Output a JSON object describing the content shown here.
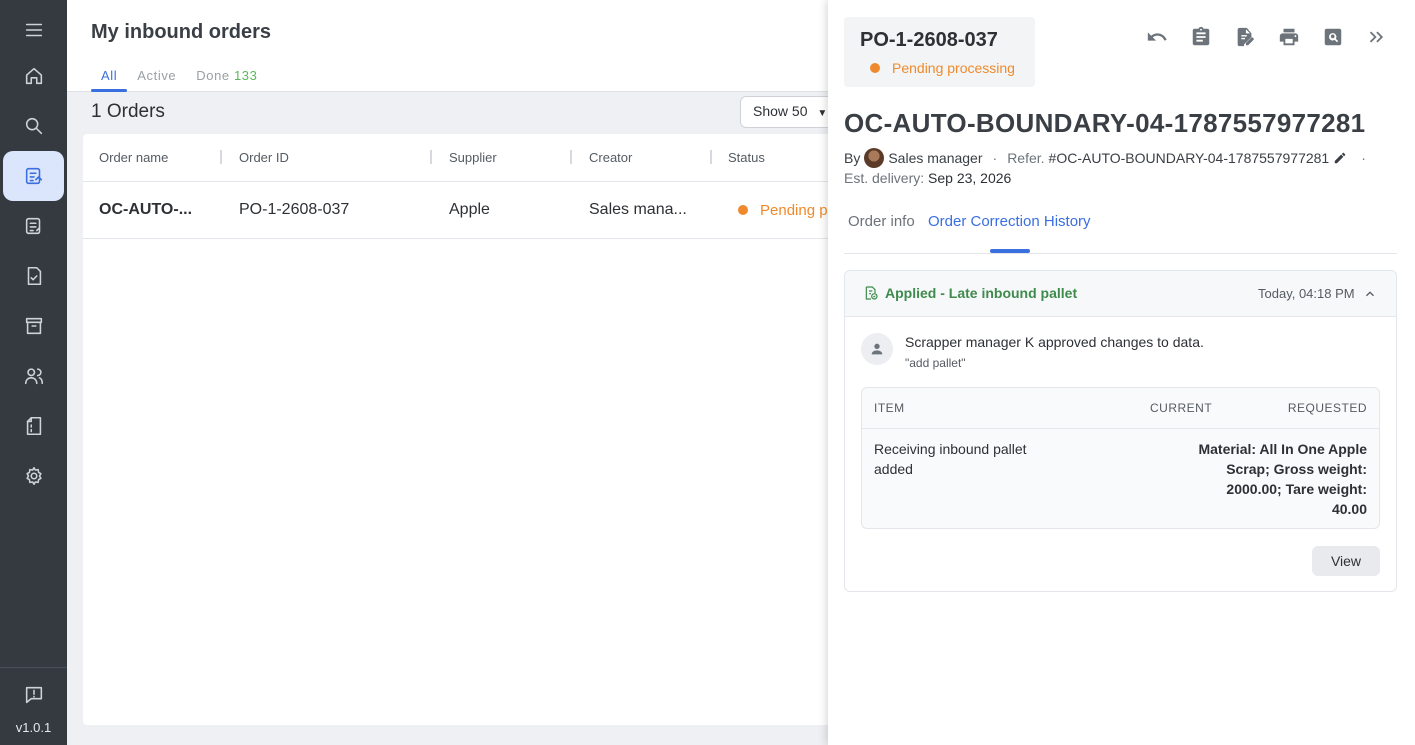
{
  "sidebar": {
    "items": [
      {
        "icon": "menu-icon"
      },
      {
        "icon": "home-icon"
      },
      {
        "icon": "search-icon"
      },
      {
        "icon": "inbound-orders-icon",
        "active": true
      },
      {
        "icon": "outbound-orders-icon"
      },
      {
        "icon": "checklist-icon"
      },
      {
        "icon": "archive-icon"
      },
      {
        "icon": "users-icon"
      },
      {
        "icon": "document-icon"
      },
      {
        "icon": "gear-icon"
      }
    ],
    "feedback_icon": "feedback-icon",
    "version": "v1.0.1"
  },
  "header": {
    "title": "My inbound orders",
    "tabs": [
      {
        "label": "All"
      },
      {
        "label": "Active"
      },
      {
        "label": "Done",
        "count": "133"
      }
    ]
  },
  "list": {
    "count_label": "1 Orders",
    "show_label": "Show 50",
    "columns": [
      "Order name",
      "Order ID",
      "Supplier",
      "Creator",
      "Status"
    ],
    "rows": [
      {
        "order_name": "OC-AUTO-...",
        "order_id": "PO-1-2608-037",
        "supplier": "Apple",
        "creator": "Sales mana...",
        "status": "Pending pr"
      }
    ]
  },
  "panel": {
    "po_number": "PO-1-2608-037",
    "status": "Pending processing",
    "order_name": "OC-AUTO-BOUNDARY-04-1787557977281",
    "by_label": "By",
    "creator": "Sales manager",
    "ref_label": "Refer.",
    "ref_value": "#OC-AUTO-BOUNDARY-04-1787557977281",
    "delivery_label": "Est. delivery:",
    "delivery_value": "Sep 23, 2026",
    "tabs": [
      {
        "label": "Order info"
      },
      {
        "label": "Order Correction History"
      }
    ],
    "correction": {
      "title": "Applied - Late inbound pallet",
      "time": "Today, 04:18 PM",
      "approver": "Scrapper manager K",
      "approved_text": "approved changes to data.",
      "note": "\"add pallet\"",
      "columns": [
        "ITEM",
        "CURRENT",
        "REQUESTED"
      ],
      "item": "Receiving inbound pallet added",
      "current": "",
      "requested": "Material: All In One Apple Scrap; Gross weight: 2000.00; Tare weight: 40.00",
      "view_label": "View"
    }
  },
  "colors": {
    "accent": "#3a6fdf",
    "pending": "#ef8a2c",
    "applied": "#3f8a4d",
    "sidebar_bg": "#353a40"
  }
}
